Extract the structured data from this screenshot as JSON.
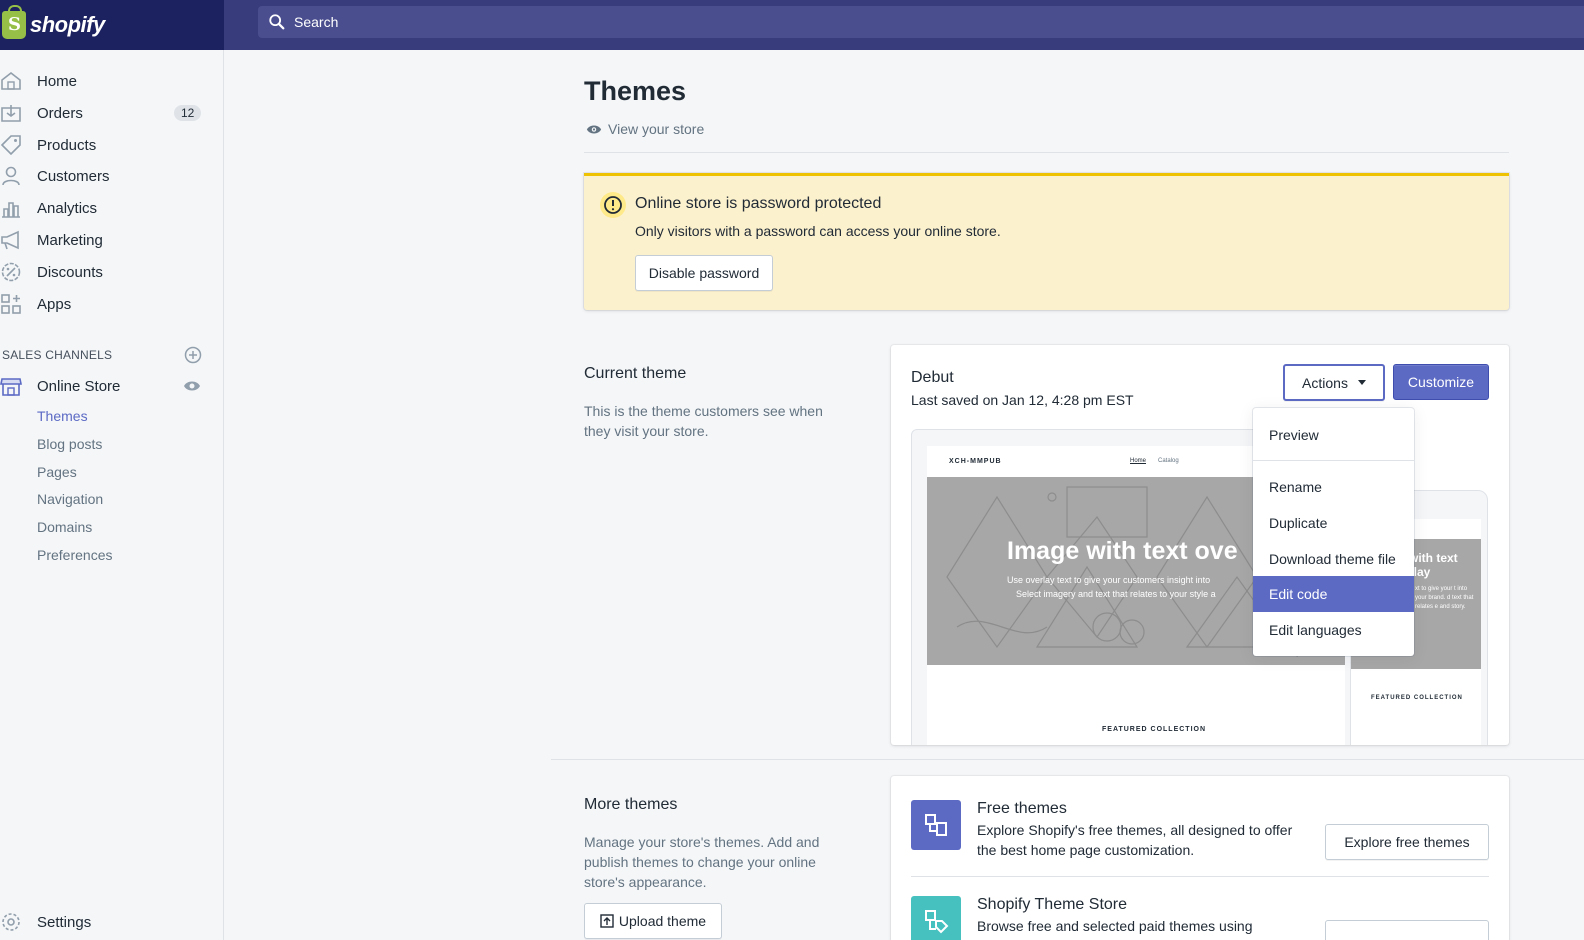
{
  "brand": {
    "name": "shopify"
  },
  "search": {
    "placeholder": "Search"
  },
  "sidebar": {
    "items": [
      {
        "label": "Home",
        "icon": "home-icon"
      },
      {
        "label": "Orders",
        "icon": "orders-icon",
        "badge": "12"
      },
      {
        "label": "Products",
        "icon": "tag-icon"
      },
      {
        "label": "Customers",
        "icon": "person-icon"
      },
      {
        "label": "Analytics",
        "icon": "bar-chart-icon"
      },
      {
        "label": "Marketing",
        "icon": "megaphone-icon"
      },
      {
        "label": "Discounts",
        "icon": "discount-icon"
      },
      {
        "label": "Apps",
        "icon": "apps-icon"
      }
    ],
    "sales_channels_title": "SALES CHANNELS",
    "online_store": "Online Store",
    "sub_items": [
      "Themes",
      "Blog posts",
      "Pages",
      "Navigation",
      "Domains",
      "Preferences"
    ],
    "active_sub_item": "Themes",
    "settings": "Settings"
  },
  "main": {
    "title": "Themes",
    "view_store": "View your store",
    "banner": {
      "title": "Online store is password protected",
      "text": "Only visitors with a password can access your online store.",
      "button": "Disable password"
    },
    "current_theme": {
      "heading": "Current theme",
      "description": "This is the theme customers see when they visit your store.",
      "theme_name": "Debut",
      "last_saved": "Last saved on Jan 12, 4:28 pm EST",
      "actions_label": "Actions",
      "customize_label": "Customize",
      "preview": {
        "shop_name": "XCH-MMPUB",
        "nav_home": "Home",
        "nav_catalog": "Catalog",
        "hero_title": "Image with text ove",
        "hero_sub1": "Use overlay text to give your customers insight into",
        "hero_sub2": "Select imagery and text that relates to your style a",
        "featured": "FEATURED COLLECTION",
        "mobile_hero_title": "with text rlay",
        "mobile_hero_sub": "xt to give your t into your brand. d text that relates e and story.",
        "mobile_featured": "FEATURED COLLECTION"
      }
    },
    "actions_menu": {
      "items": [
        "Preview",
        "Rename",
        "Duplicate",
        "Download theme file",
        "Edit code",
        "Edit languages"
      ],
      "selected": "Edit code"
    },
    "more_themes": {
      "heading": "More themes",
      "description": "Manage your store's themes. Add and publish themes to change your online store's appearance.",
      "upload_button": "Upload theme",
      "free_title": "Free themes",
      "free_desc": "Explore Shopify's free themes, all designed to offer the best home page customization.",
      "free_button": "Explore free themes",
      "store_title": "Shopify Theme Store",
      "store_desc": "Browse free and selected paid themes using search"
    }
  },
  "colors": {
    "topbar": "#393c7c",
    "logo_area": "#1c2260",
    "accent": "#5c6ac4",
    "banner_bg": "#fcf1cd",
    "banner_border": "#eec200",
    "free_theme_icon": "#5c6ac4",
    "store_icon": "#47c1bf"
  }
}
